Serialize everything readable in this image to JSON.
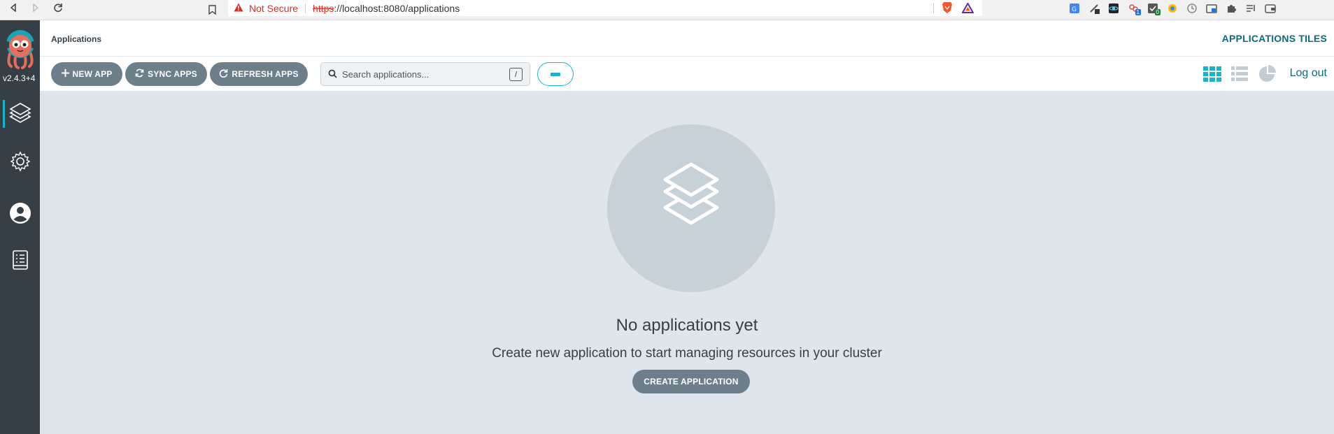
{
  "browser": {
    "security_label": "Not Secure",
    "url_scheme": "https",
    "url_rest": "://localhost:8080/applications",
    "extension_badges": [
      "1",
      "0"
    ]
  },
  "sidebar": {
    "version": "v2.4.3+4"
  },
  "header": {
    "title": "Applications",
    "view_title": "APPLICATIONS TILES"
  },
  "toolbar": {
    "new_app_label": "NEW APP",
    "sync_apps_label": "SYNC APPS",
    "refresh_apps_label": "REFRESH APPS",
    "search_placeholder": "Search applications...",
    "search_shortcut": "/",
    "logout_label": "Log out"
  },
  "empty_state": {
    "title": "No applications yet",
    "subtitle": "Create new application to start managing resources in your cluster",
    "create_label": "CREATE APPLICATION"
  },
  "colors": {
    "sidebar_bg": "#363f45",
    "accent": "#19b3c9",
    "button_bg": "#6d7f8b",
    "main_bg": "#dee6eb"
  }
}
